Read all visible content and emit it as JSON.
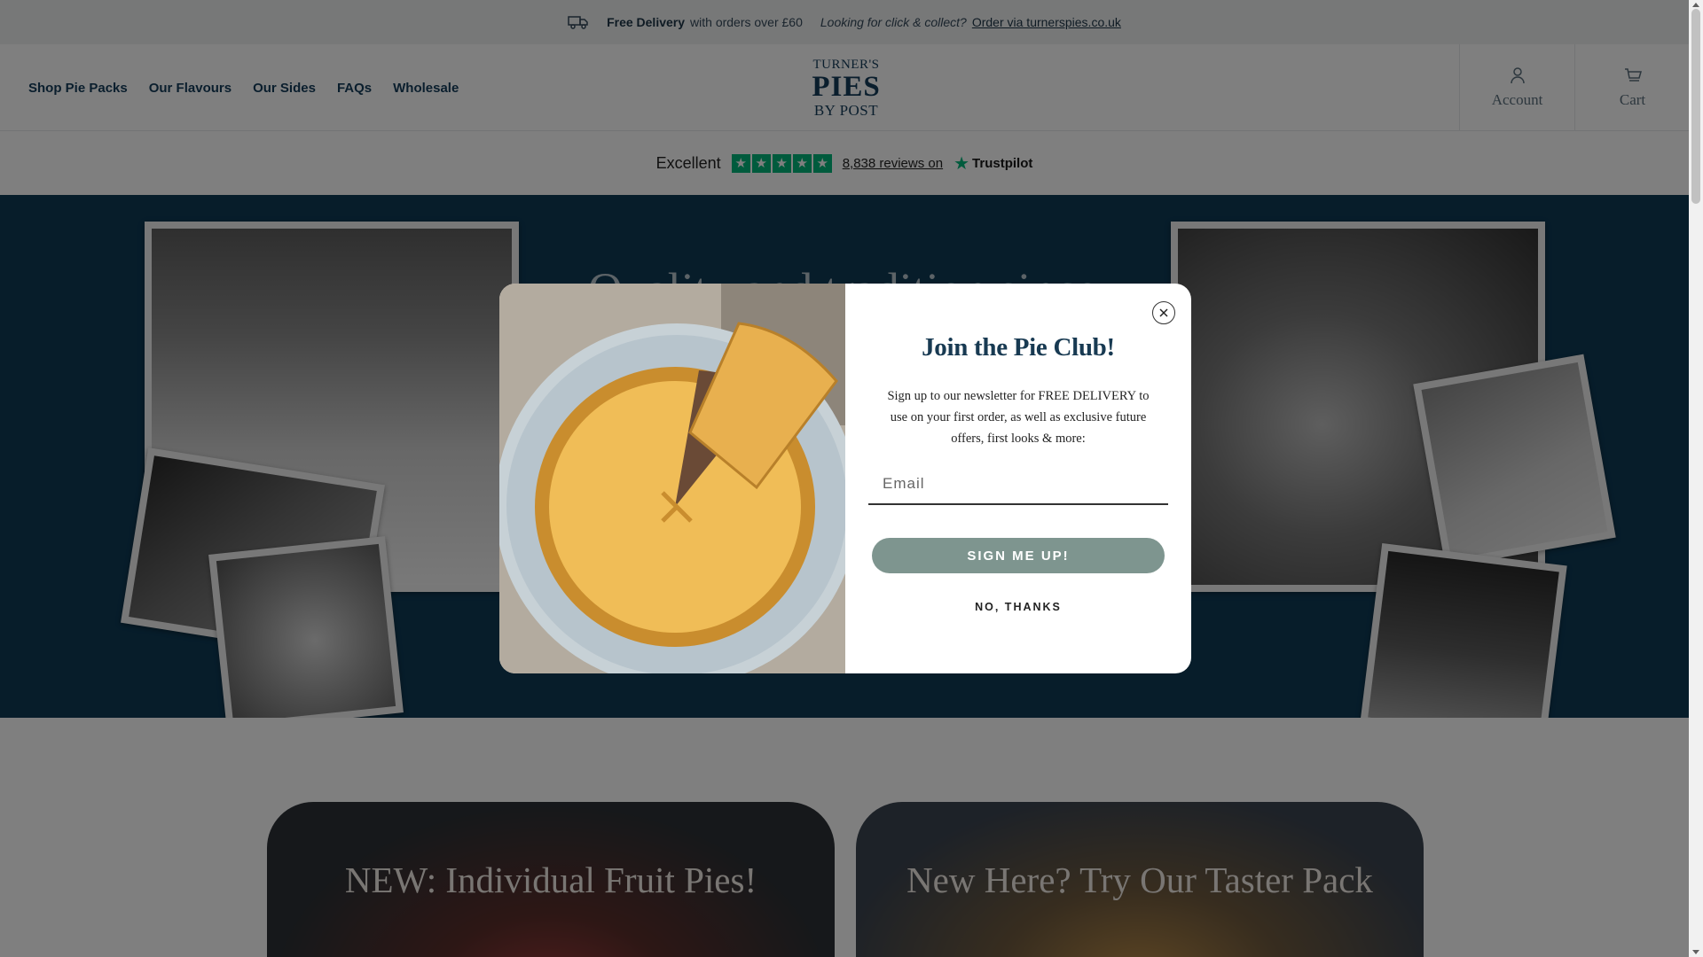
{
  "announcement": {
    "free_delivery": "Free Delivery",
    "delivery_detail": "with orders over £60",
    "click_collect": "Looking for click & collect?",
    "click_collect_link": "Order via turnerspies.co.uk"
  },
  "nav": {
    "items": [
      "Shop Pie Packs",
      "Our Flavours",
      "Our Sides",
      "FAQs",
      "Wholesale"
    ]
  },
  "logo": {
    "line1": "TURNER'S",
    "line2": "PIES",
    "line3": "BY POST"
  },
  "header": {
    "account_label": "Account",
    "cart_label": "Cart"
  },
  "trustpilot": {
    "rating_text": "Excellent",
    "reviews_text": "8,838 reviews on",
    "brand": "Trustpilot",
    "stars": 5,
    "star_color": "#00b67a"
  },
  "hero": {
    "title_partial": "Quality and tradition since",
    "background": "#0e3a55"
  },
  "cards": [
    {
      "title": "NEW: Individual Fruit Pies!"
    },
    {
      "title": "New Here? Try Our Taster Pack"
    }
  ],
  "modal": {
    "title": "Join the Pie Club!",
    "body": "Sign up to our newsletter for FREE DELIVERY to use on your first order, as well as exclusive future offers, first looks & more:",
    "email_placeholder": "Email",
    "signup_label": "SIGN ME UP!",
    "decline_label": "NO, THANKS",
    "button_color": "#7e958f"
  },
  "icons": {
    "truck": "truck-icon",
    "account": "user-icon",
    "cart": "cart-icon",
    "close": "close-icon"
  }
}
